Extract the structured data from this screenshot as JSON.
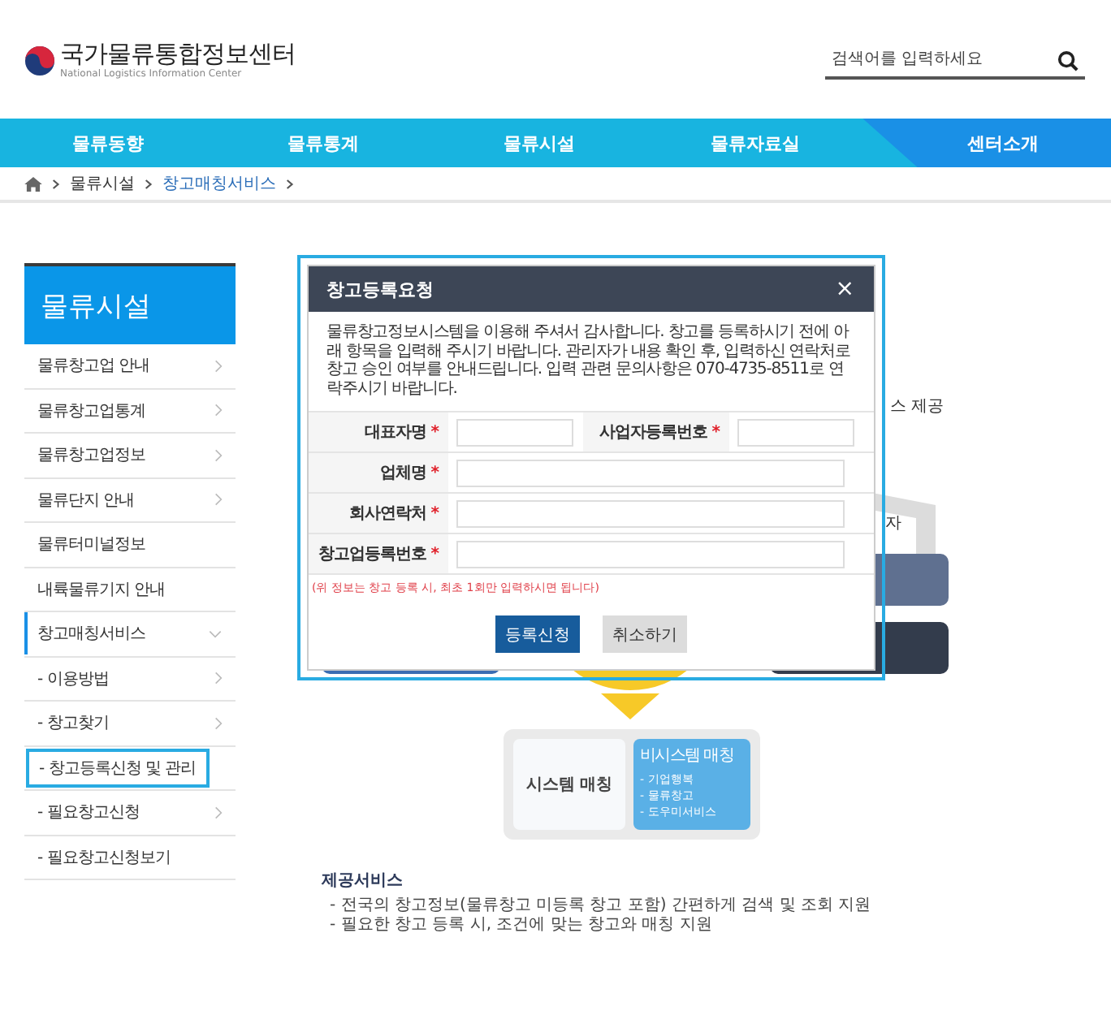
{
  "header": {
    "logo_title": "국가물류통합정보센터",
    "logo_subtitle": "National Logistics Information Center",
    "search": {
      "placeholder": "검색어를 입력하세요"
    }
  },
  "nav": [
    {
      "label": "물류동향",
      "selected": false
    },
    {
      "label": "물류통계",
      "selected": false
    },
    {
      "label": "물류시설",
      "selected": false
    },
    {
      "label": "물류자료실",
      "selected": false
    },
    {
      "label": "센터소개",
      "selected": true
    }
  ],
  "breadcrumb": [
    {
      "label": "물류시설",
      "current": false
    },
    {
      "label": "창고매칭서비스",
      "current": true
    }
  ],
  "sidebar": {
    "title": "물류시설",
    "items": [
      {
        "label": "물류창고업 안내",
        "kind": "menu",
        "arrow": true,
        "selected": false
      },
      {
        "label": "물류창고업통계",
        "kind": "menu",
        "arrow": true,
        "selected": false
      },
      {
        "label": "물류창고업정보",
        "kind": "menu",
        "arrow": true,
        "selected": false
      },
      {
        "label": "물류단지 안내",
        "kind": "menu",
        "arrow": true,
        "selected": false
      },
      {
        "label": "물류터미널정보",
        "kind": "menu",
        "arrow": false,
        "selected": false
      },
      {
        "label": "내륙물류기지 안내",
        "kind": "menu",
        "arrow": false,
        "selected": false
      },
      {
        "label": "창고매칭서비스",
        "kind": "group",
        "expanded": true,
        "selected": true
      },
      {
        "label": "- 이용방법",
        "kind": "submenu",
        "arrow": true,
        "selected": false
      },
      {
        "label": "- 창고찾기",
        "kind": "submenu",
        "arrow": true,
        "selected": false
      },
      {
        "label": "- 창고등록신청 및 관리",
        "kind": "submenu",
        "arrow": false,
        "selected": true
      },
      {
        "label": "- 필요창고신청",
        "kind": "submenu",
        "arrow": true,
        "selected": false
      },
      {
        "label": "- 필요창고신청보기",
        "kind": "submenu",
        "arrow": false,
        "selected": false
      }
    ]
  },
  "diagram": {
    "texts": [
      "스 제공",
      "자"
    ],
    "system_matching": "시스템 매칭",
    "non_system_matching": {
      "title": "비시스템 매칭",
      "items": [
        "- 기업행복",
        "- 물류창고",
        "- 도우미서비스"
      ]
    }
  },
  "services": {
    "title": "제공서비스",
    "lines": [
      "- 전국의 창고정보(물류창고 미등록 창고 포함) 간편하게 검색 및 조회 지원",
      "- 필요한 창고 등록 시, 조건에 맞는 창고와 매칭 지원"
    ]
  },
  "modal": {
    "highlighted": true,
    "title": "창고등록요청",
    "close": "×",
    "intro": "물류창고정보시스템을 이용해 주셔서 감사합니다. 창고를 등록하시기 전에 아래 항목을 입력해 주시기 바랍니다. 관리자가 내용 확인 후, 입력하신 연락처로 창고 승인 여부를 안내드립니다. 입력 관련 문의사항은 070-4735-8511로 연락주시기 바랍니다.",
    "rows": [
      {
        "fields": [
          {
            "label": "대표자명",
            "required": true
          },
          {
            "label": "사업자등록번호",
            "required": true
          }
        ]
      },
      {
        "fields": [
          {
            "label": "업체명",
            "required": true
          }
        ]
      },
      {
        "fields": [
          {
            "label": "회사연락처",
            "required": true
          }
        ]
      },
      {
        "fields": [
          {
            "label": "창고업등록번호",
            "required": true
          }
        ]
      }
    ],
    "required_mark": "*",
    "note": "(위 정보는 창고 등록 시, 최초 1회만 입력하시면 됩니다)",
    "buttons": [
      {
        "label": "등록신청",
        "kind": "primary"
      },
      {
        "label": "취소하기",
        "kind": "secondary"
      }
    ]
  }
}
